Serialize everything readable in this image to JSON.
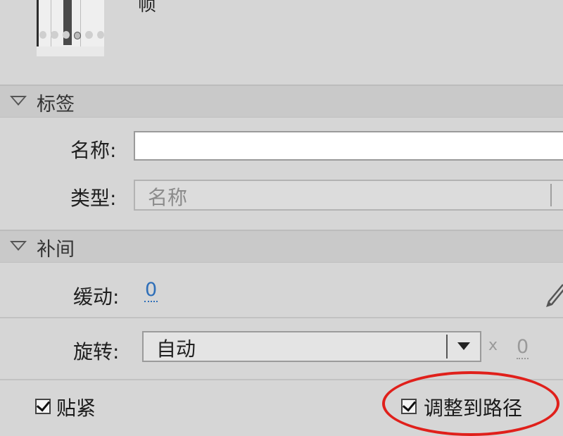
{
  "frame": {
    "label": "帧"
  },
  "labels_section": {
    "title": "标签",
    "name_label": "名称:",
    "name_value": "",
    "type_label": "类型:",
    "type_value": "名称"
  },
  "tween_section": {
    "title": "补间",
    "ease_label": "缓动:",
    "ease_value": "0",
    "rotate_label": "旋转:",
    "rotate_value": "自动",
    "times_label": "x",
    "rotate_count": "0",
    "snap_label": "贴紧",
    "snap_checked": true,
    "orient_label": "调整到路径",
    "orient_checked": true
  },
  "highlight_color": "#e0201b"
}
